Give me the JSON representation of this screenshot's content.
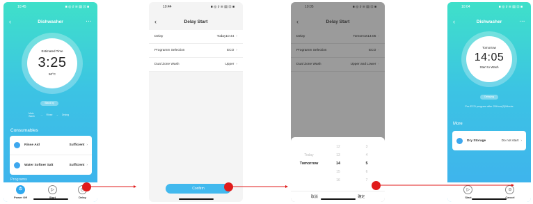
{
  "screen1": {
    "time": "10:45",
    "status_icons": "■ ◎ ♯ ≋ ▤ ⊡ ■",
    "title": "Dishwasher",
    "dial": {
      "label": "Estimated Time",
      "time": "3:25",
      "temp": "50°C"
    },
    "status_pill": "Stand by",
    "stages": [
      "Main Wash",
      "Rinse",
      "Drying"
    ],
    "consumables_title": "Consumables",
    "consumables": [
      {
        "name": "Rinse Aid",
        "value": "Sufficient"
      },
      {
        "name": "Water Softner Salt",
        "value": "Sufficient"
      }
    ],
    "programs_title": "Programs",
    "bottom": [
      {
        "label": "Power Off",
        "icon": "power-icon"
      },
      {
        "label": "Start",
        "icon": "play-icon"
      },
      {
        "label": "Delay",
        "icon": "clock-icon"
      }
    ]
  },
  "screen2": {
    "time": "10:44",
    "title": "Delay Start",
    "rows": [
      {
        "name": "Delay",
        "value": "Today10:44"
      },
      {
        "name": "Programm Selection",
        "value": "ECO"
      },
      {
        "name": "Dual Zone Wash",
        "value": "Upper"
      }
    ],
    "confirm": "Confirm"
  },
  "screen3": {
    "time": "10:05",
    "title": "Delay Start",
    "rows": [
      {
        "name": "Delay",
        "value": "Tomorrow14:05"
      },
      {
        "name": "Programm Selection",
        "value": "ECO"
      },
      {
        "name": "Dual Zone Wash",
        "value": "Upper and Lower"
      }
    ],
    "picker": {
      "day": [
        "",
        "Today",
        "Tomorrow",
        "",
        ""
      ],
      "hour": [
        "12",
        "13",
        "14",
        "15",
        "16"
      ],
      "minute": [
        "3",
        "4",
        "5",
        "6",
        "7"
      ]
    },
    "cancel": "取消",
    "ok": "确定"
  },
  "screen4": {
    "time": "10:04",
    "title": "Dishwasher",
    "dial": {
      "label": "Tomorrow",
      "time": "14:05",
      "sub": "Start to Wash"
    },
    "status_pill": "Delaying",
    "program_line": "Pre-ECO program after 20Hour(S)Minute",
    "more_title": "More",
    "more_item": {
      "name": "Dry Storage",
      "value": "Do not start"
    },
    "bottom": [
      {
        "label": "Start",
        "icon": "play-icon"
      },
      {
        "label": "Cancel",
        "icon": "stop-icon"
      }
    ]
  },
  "colors": {
    "accent": "#42b9ee",
    "marker": "#e01b1b",
    "gradient_top": "#3fe0c9",
    "gradient_bottom": "#3fb1ee"
  }
}
